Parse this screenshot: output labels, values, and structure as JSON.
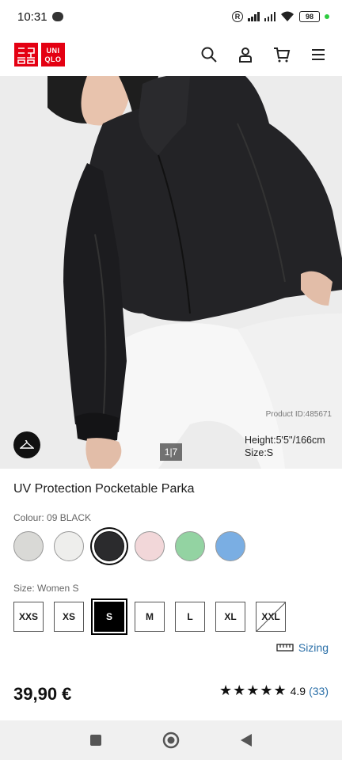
{
  "status_bar": {
    "time": "10:31",
    "battery": "98"
  },
  "header": {
    "logo_top": "ユニ\nクロ",
    "logo_bottom": "UNI\nQLO",
    "icons": [
      "search-icon",
      "account-icon",
      "cart-icon",
      "menu-icon"
    ]
  },
  "hero": {
    "image_counter": "1|7",
    "product_id": "Product ID:485671",
    "model_height": "Height:5'5''/166cm",
    "model_size": "Size:S"
  },
  "product": {
    "title": "UV Protection Pocketable Parka",
    "colour_label": "Colour: 09 BLACK",
    "colours": [
      {
        "hex": "#d9d9d6"
      },
      {
        "hex": "#eeeeec"
      },
      {
        "hex": "#2b2b2d",
        "selected": true
      },
      {
        "hex": "#f2d7d9"
      },
      {
        "hex": "#93d3a2"
      },
      {
        "hex": "#7aaee3"
      }
    ],
    "size_label": "Size: Women S",
    "sizes": [
      {
        "label": "XXS"
      },
      {
        "label": "XS"
      },
      {
        "label": "S",
        "selected": true
      },
      {
        "label": "M"
      },
      {
        "label": "L"
      },
      {
        "label": "XL"
      },
      {
        "label": "XXL",
        "unavailable": true
      }
    ],
    "sizing_link": "Sizing",
    "price": "39,90 €",
    "stars": "★★★★★",
    "rating_value": "4.9",
    "rating_count": "(33)"
  },
  "colors": {
    "brand_red": "#e40012",
    "link_blue": "#2a6fa8"
  }
}
